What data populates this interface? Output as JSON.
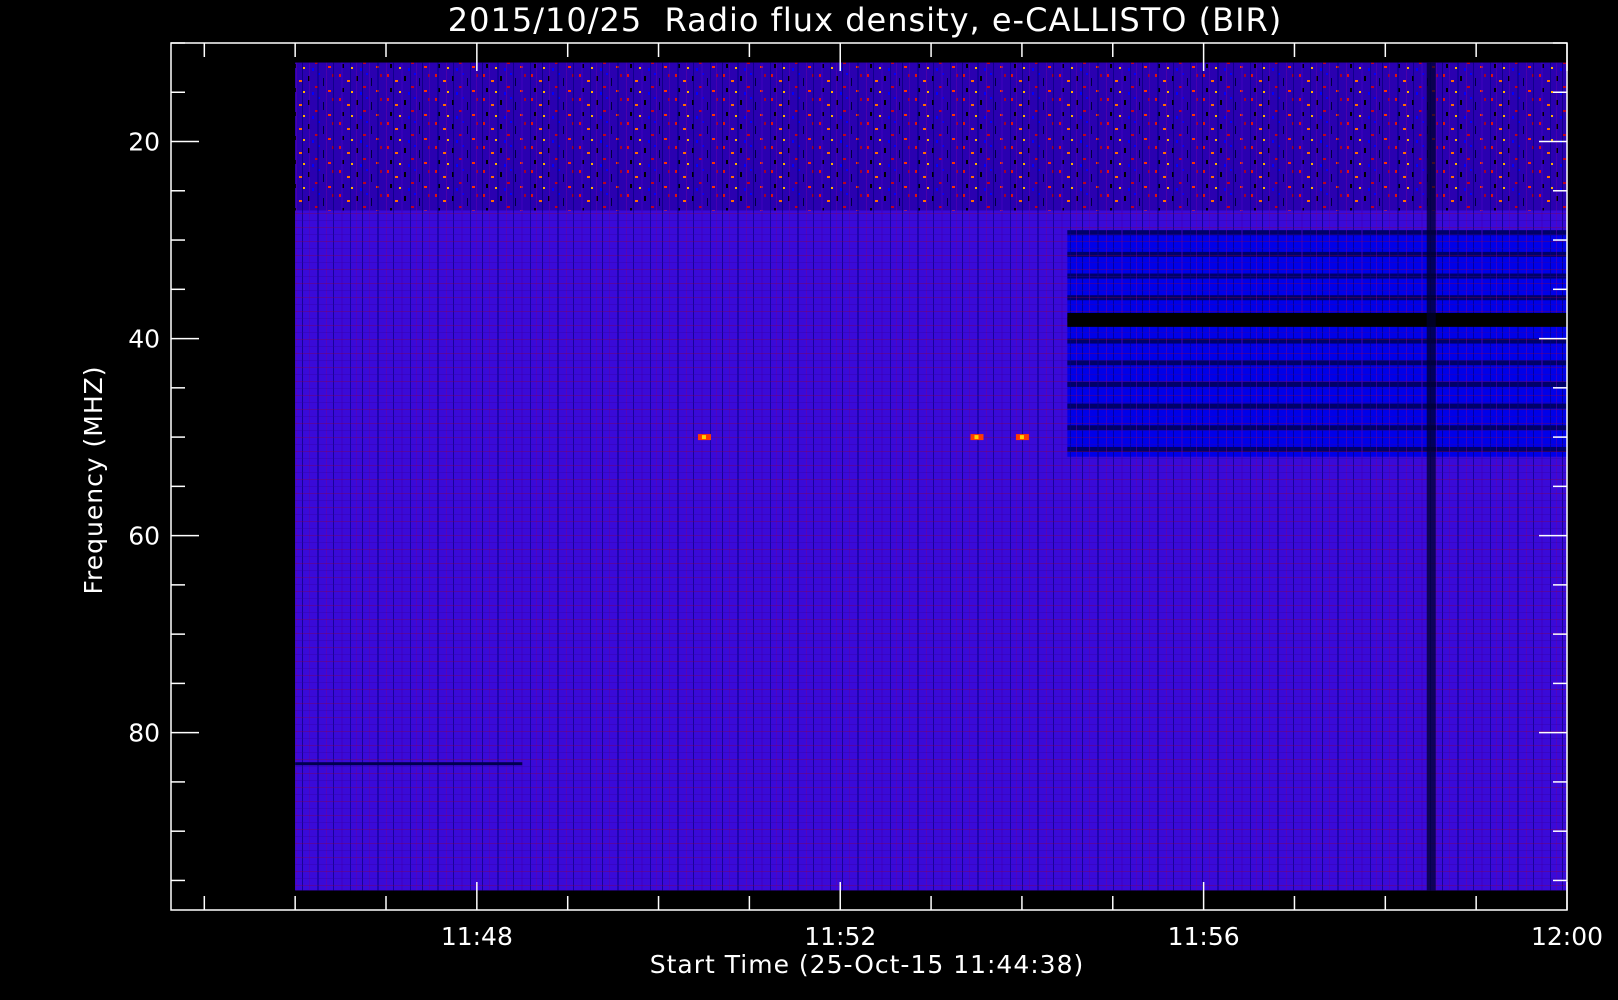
{
  "chart_data": {
    "type": "heatmap",
    "title": "2015/10/25  Radio flux density, e-CALLISTO (BIR)",
    "xlabel": "Start Time (25-Oct-15 11:44:38)",
    "ylabel": "Frequency (MHZ)",
    "x": {
      "unit": "time",
      "range": [
        "11:44:38",
        "12:00:00"
      ],
      "data_range": [
        "11:46:00",
        "12:00:00"
      ],
      "major_ticks": [
        "11:48",
        "11:52",
        "11:56",
        "12:00"
      ],
      "minor_tick_interval_min": 1
    },
    "y": {
      "unit": "MHz",
      "inverted": true,
      "range": [
        10,
        98
      ],
      "data_range": [
        12,
        96
      ],
      "major_ticks": [
        20,
        40,
        60,
        80
      ],
      "minor_tick_interval": 5
    },
    "colormap": [
      "#000000",
      "#0000ff",
      "#4b00e6",
      "#c0102a",
      "#ff3a00",
      "#ffd000"
    ],
    "regions": [
      {
        "label": "upper noisy band",
        "freq_range": [
          12,
          27
        ],
        "time_range": [
          "11:46:00",
          "12:00:00"
        ],
        "level": "high"
      },
      {
        "label": "background",
        "freq_range": [
          27,
          96
        ],
        "time_range": [
          "11:46:00",
          "12:00:00"
        ],
        "level": "medium"
      },
      {
        "label": "attenuated block",
        "freq_range": [
          29,
          52
        ],
        "time_range": [
          "11:54:30",
          "12:00:00"
        ],
        "level": "low"
      }
    ],
    "features": [
      {
        "label": "dark band",
        "freq": 38,
        "time_range": [
          "11:54:30",
          "12:00:00"
        ]
      },
      {
        "label": "dark line",
        "freq": 83,
        "time_range": [
          "11:46:00",
          "11:48:30"
        ]
      },
      {
        "label": "dark column",
        "time": "11:58:30",
        "freq_range": [
          12,
          96
        ]
      },
      {
        "label": "hot spot",
        "freq": 50,
        "time": "11:50:30"
      },
      {
        "label": "hot spot",
        "freq": 50,
        "time": "11:53:30"
      },
      {
        "label": "hot spot",
        "freq": 50,
        "time": "11:54:00"
      }
    ]
  }
}
